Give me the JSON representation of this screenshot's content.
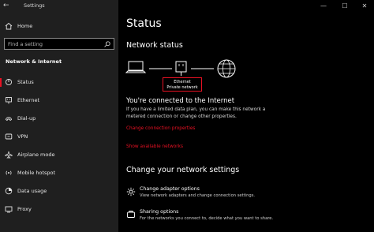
{
  "window": {
    "app_title": "Settings",
    "controls": {
      "minimize": "—",
      "maximize": "☐",
      "close": "✕"
    }
  },
  "sidebar": {
    "home_label": "Home",
    "search_placeholder": "Find a setting",
    "section_title": "Network & Internet",
    "items": [
      {
        "label": "Status",
        "icon": "status-icon",
        "active": true
      },
      {
        "label": "Ethernet",
        "icon": "ethernet-icon"
      },
      {
        "label": "Dial-up",
        "icon": "dial-up-icon"
      },
      {
        "label": "VPN",
        "icon": "vpn-icon"
      },
      {
        "label": "Airplane mode",
        "icon": "airplane-icon"
      },
      {
        "label": "Mobile hotspot",
        "icon": "hotspot-icon"
      },
      {
        "label": "Data usage",
        "icon": "data-usage-icon"
      },
      {
        "label": "Proxy",
        "icon": "proxy-icon"
      }
    ]
  },
  "main": {
    "title": "Status",
    "network_status_heading": "Network status",
    "ethernet_label": "Ethernet",
    "network_profile": "Private network",
    "connected_title": "You're connected to the Internet",
    "connected_desc": "If you have a limited data plan, you can make this network a metered connection or change other properties.",
    "change_properties_link": "Change connection properties",
    "show_networks_link": "Show available networks",
    "change_settings_heading": "Change your network settings",
    "options": [
      {
        "title": "Change adapter options",
        "desc": "View network adapters and change connection settings.",
        "icon": "adapter-icon"
      },
      {
        "title": "Sharing options",
        "desc": "For the networks you connect to, decide what you want to share.",
        "icon": "sharing-icon"
      }
    ]
  },
  "colors": {
    "accent": "#e81123",
    "sidebar_bg": "#1f1f1f",
    "main_bg": "#000000"
  }
}
